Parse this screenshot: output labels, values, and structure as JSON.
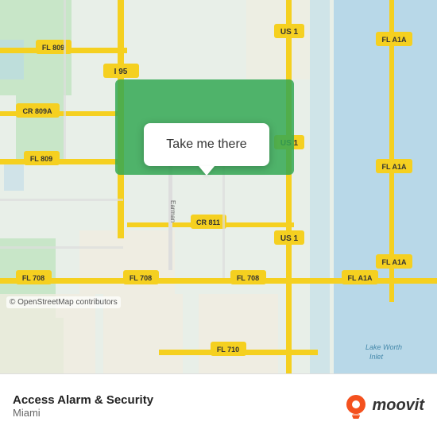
{
  "map": {
    "attribution": "© OpenStreetMap contributors",
    "bg_color": "#e8f4f0"
  },
  "tooltip": {
    "label": "Take me there"
  },
  "bottom_bar": {
    "location_name": "Access Alarm & Security",
    "location_city": "Miami",
    "moovit_label": "moovit"
  },
  "road_labels": [
    {
      "id": "i95",
      "text": "I 95"
    },
    {
      "id": "us1_top",
      "text": "US 1"
    },
    {
      "id": "us1_mid",
      "text": "US 1"
    },
    {
      "id": "us1_bot",
      "text": "US 1"
    },
    {
      "id": "fl809_top",
      "text": "FL 809"
    },
    {
      "id": "fl809_bot",
      "text": "FL 809"
    },
    {
      "id": "fl708_left",
      "text": "FL 708"
    },
    {
      "id": "fl708_mid",
      "text": "FL 708"
    },
    {
      "id": "fl708_right",
      "text": "FL 708"
    },
    {
      "id": "fl710",
      "text": "FL 710"
    },
    {
      "id": "cr809a",
      "text": "CR 809A"
    },
    {
      "id": "cr811",
      "text": "CR 811"
    },
    {
      "id": "fla1a_top",
      "text": "FL A1A"
    },
    {
      "id": "fla1a_mid",
      "text": "FL A1A"
    },
    {
      "id": "fla1a_bot",
      "text": "FL A1A"
    }
  ],
  "colors": {
    "map_bg": "#e8f4e8",
    "water": "#a8d4e6",
    "road_yellow": "#f5d020",
    "road_white": "#ffffff",
    "green_region": "#34a853",
    "tooltip_bg": "#ffffff",
    "bottom_bar_bg": "#ffffff"
  }
}
